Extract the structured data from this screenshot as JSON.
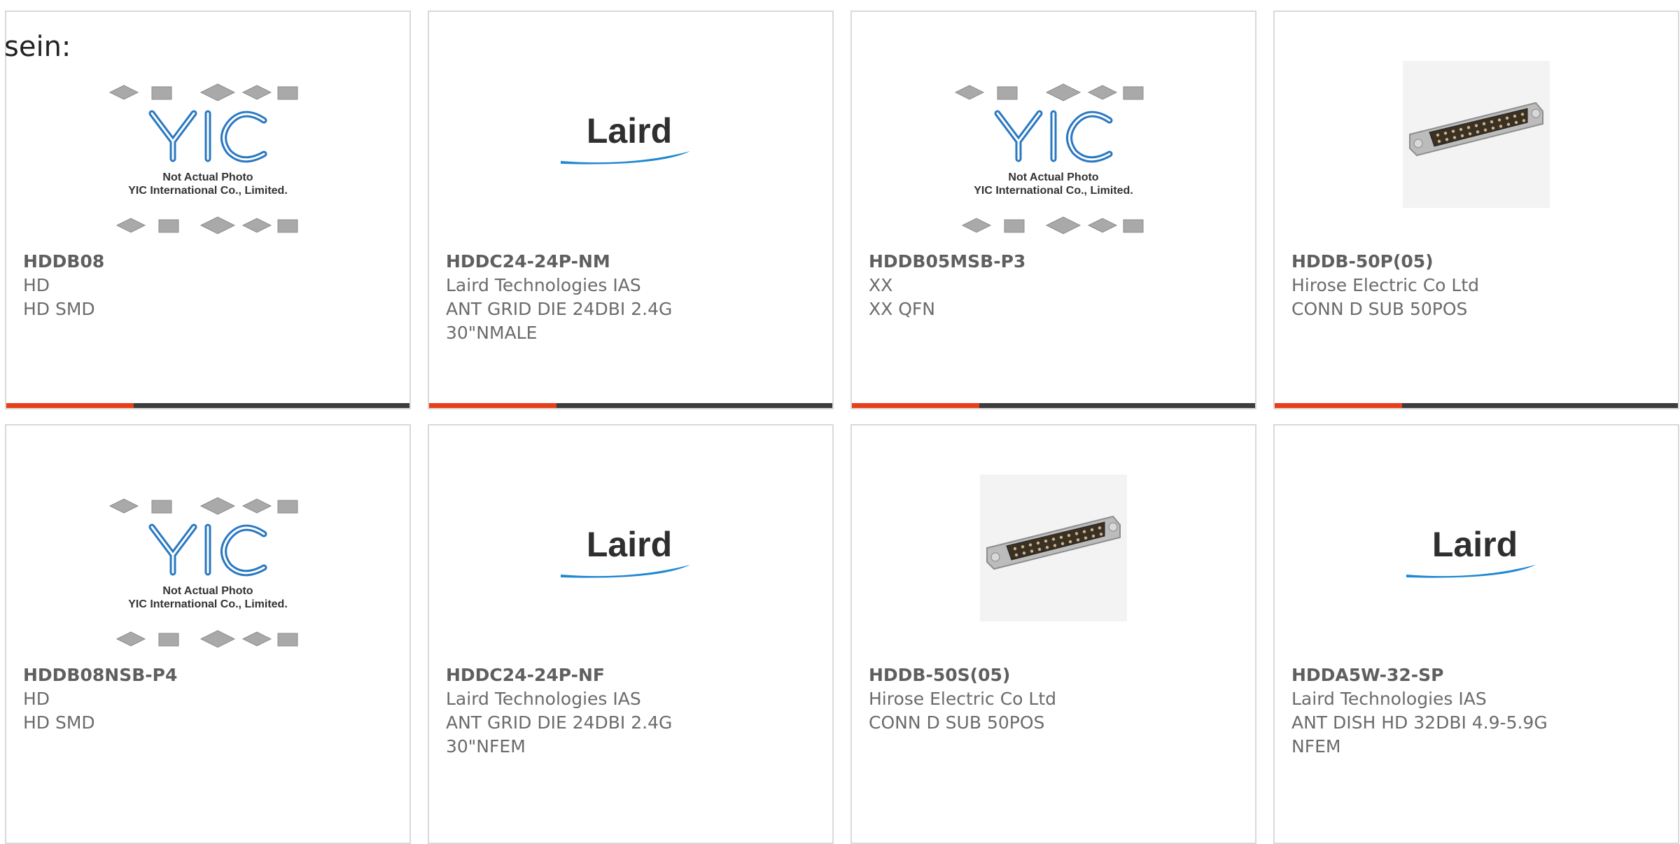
{
  "intro_text": "sein:",
  "colors": {
    "accent": "#e6401a",
    "bar": "#3c3c3c",
    "border": "#d9d9d9",
    "text": "#6b6b6b"
  },
  "products": [
    {
      "part": "HDDB08",
      "manufacturer": "HD",
      "description": "HD SMD",
      "description2": "",
      "image": "yic-placeholder-image",
      "placeholder_line1": "Not Actual Photo",
      "placeholder_line2": "YIC International Co., Limited."
    },
    {
      "part": "HDDC24-24P-NM",
      "manufacturer": "Laird Technologies IAS",
      "description": "ANT GRID DIE 24DBI 2.4G",
      "description2": "30\"NMALE",
      "image": "laird-logo",
      "logo_text": "Laird"
    },
    {
      "part": "HDDB05MSB-P3",
      "manufacturer": "XX",
      "description": "XX QFN",
      "description2": "",
      "image": "yic-placeholder-image",
      "placeholder_line1": "Not Actual Photo",
      "placeholder_line2": "YIC International Co., Limited."
    },
    {
      "part": "HDDB-50P(05)",
      "manufacturer": "Hirose Electric Co Ltd",
      "description": "CONN D SUB 50POS",
      "description2": "",
      "image": "dsub-connector-photo"
    },
    {
      "part": "HDDB08NSB-P4",
      "manufacturer": "HD",
      "description": "HD SMD",
      "description2": "",
      "image": "yic-placeholder-image",
      "placeholder_line1": "Not Actual Photo",
      "placeholder_line2": "YIC International Co., Limited."
    },
    {
      "part": "HDDC24-24P-NF",
      "manufacturer": "Laird Technologies IAS",
      "description": "ANT GRID DIE 24DBI 2.4G",
      "description2": "30\"NFEM",
      "image": "laird-logo",
      "logo_text": "Laird"
    },
    {
      "part": "HDDB-50S(05)",
      "manufacturer": "Hirose Electric Co Ltd",
      "description": "CONN D SUB 50POS",
      "description2": "",
      "image": "dsub-connector-photo"
    },
    {
      "part": "HDDA5W-32-SP",
      "manufacturer": "Laird Technologies IAS",
      "description": "ANT DISH HD 32DBI 4.9-5.9G",
      "description2": "NFEM",
      "image": "laird-logo",
      "logo_text": "Laird"
    }
  ]
}
